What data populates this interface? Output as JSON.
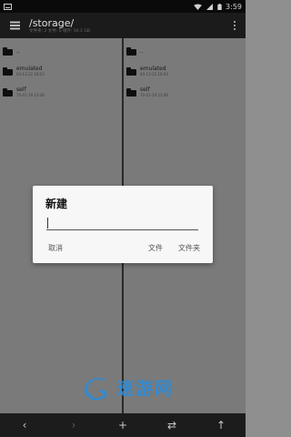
{
  "status_bar": {
    "time": "3:59",
    "icons": [
      "keyboard-icon",
      "wifi-icon",
      "signal-icon",
      "battery-icon"
    ]
  },
  "toolbar": {
    "title": "/storage/",
    "subtitle": "文件夹: 2 文件: 0 储存: 50.1 GB"
  },
  "panes": [
    {
      "items": [
        {
          "name": "..",
          "meta": ""
        },
        {
          "name": "emulated",
          "meta": "04-13-22 18:03"
        },
        {
          "name": "self",
          "meta": "70-01-19 23:46"
        }
      ]
    },
    {
      "items": [
        {
          "name": "..",
          "meta": ""
        },
        {
          "name": "emulated",
          "meta": "04-13-22 18:03"
        },
        {
          "name": "self",
          "meta": "70-01-19 23:46"
        }
      ]
    }
  ],
  "dialog": {
    "title": "新建",
    "input_value": "",
    "cancel": "取消",
    "file": "文件",
    "folder": "文件夹"
  },
  "bottom_bar": {
    "back": "‹",
    "forward": "›",
    "add": "+",
    "swap": "⇄",
    "up": "↑"
  },
  "watermark": {
    "text": "速游网"
  },
  "colors": {
    "dialog_bg": "#f7f7f7",
    "toolbar_bg": "#1b1b1b",
    "watermark_blue": "#2e8bd8"
  }
}
